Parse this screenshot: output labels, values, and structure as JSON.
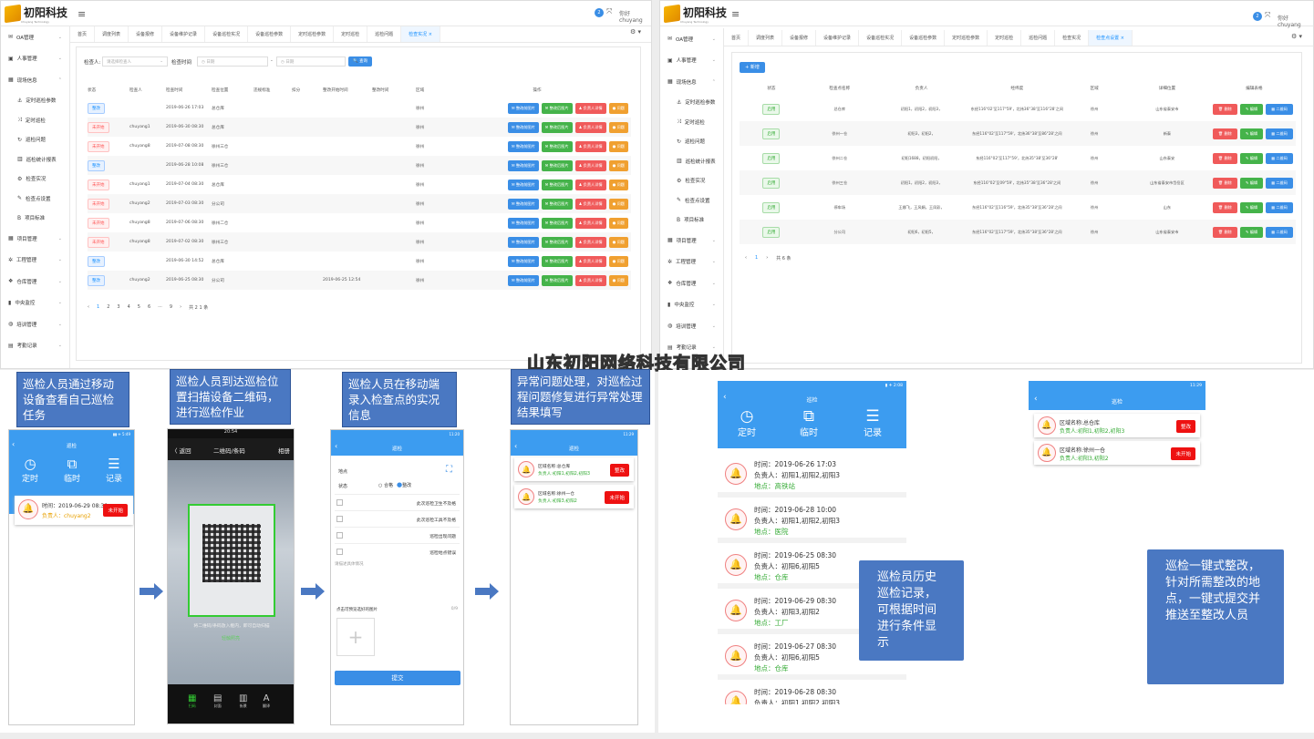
{
  "company_logo": "初阳科技",
  "company_logo_sub": "Chuyang Technology",
  "user_greeting": "你好 chuyang",
  "user_badge": "2",
  "watermark": "山东初阳网络科技有限公司",
  "left_window": {
    "sidebar": [
      {
        "label": "OA管理",
        "icon": "mail-icon",
        "chevron": "⌄",
        "sub": false
      },
      {
        "label": "人事管理",
        "icon": "id-card-icon",
        "chevron": "⌄",
        "sub": false
      },
      {
        "label": "现场信息",
        "icon": "grid-icon",
        "chevron": "⌃",
        "sub": false
      },
      {
        "label": "定时巡检参数",
        "icon": "anchor-icon",
        "sub": true
      },
      {
        "label": "定时巡检",
        "icon": "shuffle-icon",
        "sub": true
      },
      {
        "label": "巡检问题",
        "icon": "refresh-icon",
        "sub": true
      },
      {
        "label": "巡检统计报表",
        "icon": "bar-chart-icon",
        "sub": true
      },
      {
        "label": "检查实况",
        "icon": "gear-icon",
        "sub": true
      },
      {
        "label": "检查点设置",
        "icon": "edit-icon",
        "sub": true
      },
      {
        "label": "项目标准",
        "icon": "bold-icon",
        "sub": true
      },
      {
        "label": "项目管理",
        "icon": "grid-icon",
        "chevron": "⌄",
        "sub": false
      },
      {
        "label": "工程管理",
        "icon": "settings-icon",
        "chevron": "⌄",
        "sub": false
      },
      {
        "label": "仓库管理",
        "icon": "cube-icon",
        "chevron": "⌄",
        "sub": false
      },
      {
        "label": "中央监控",
        "icon": "monitor-icon",
        "chevron": "⌄",
        "sub": false
      },
      {
        "label": "培训管理",
        "icon": "globe-icon",
        "chevron": "⌄",
        "sub": false
      },
      {
        "label": "考勤记录",
        "icon": "calendar-icon",
        "chevron": "⌄",
        "sub": false
      }
    ],
    "tabs": [
      "首页",
      "调度列表",
      "设备报修",
      "设备维护记录",
      "设备巡检实况",
      "设备巡检参数",
      "定时巡检参数",
      "定时巡检",
      "巡检问题",
      "检查实况 ×"
    ],
    "active_tab": 9,
    "filter": {
      "person_label": "检查人:",
      "person_placeholder": "请选择检查人",
      "time_label": "检查时间",
      "date_placeholder": "◷ 日期",
      "dash": "-",
      "search_btn": "🔍 查询"
    },
    "columns": [
      "状态",
      "检查人",
      "检查时间",
      "检查位置",
      "违规标准",
      "扣分",
      "整改开始时间",
      "整改时间",
      "区域",
      "操作"
    ],
    "rows": [
      {
        "status": "整改",
        "status_type": "b",
        "person": "",
        "time": "2019-06-26 17:03",
        "place": "总仓库",
        "start": "",
        "area": "徐州"
      },
      {
        "status": "未开始",
        "status_type": "r",
        "person": "chuyang1",
        "time": "2019-06-30 08:30",
        "place": "总仓库",
        "start": "",
        "area": "徐州"
      },
      {
        "status": "未开始",
        "status_type": "r",
        "person": "chuyang8",
        "time": "2019-07-08 08:30",
        "place": "徐州三仓",
        "start": "",
        "area": "徐州"
      },
      {
        "status": "整改",
        "status_type": "b",
        "person": "",
        "time": "2019-06-28 10:08",
        "place": "徐州三仓",
        "start": "",
        "area": "徐州"
      },
      {
        "status": "未开始",
        "status_type": "r",
        "person": "chuyang1",
        "time": "2019-07-04 08:30",
        "place": "总仓库",
        "start": "",
        "area": "徐州"
      },
      {
        "status": "未开始",
        "status_type": "r",
        "person": "chuyang2",
        "time": "2019-07-03 08:30",
        "place": "分公司",
        "start": "",
        "area": "徐州"
      },
      {
        "status": "未开始",
        "status_type": "r",
        "person": "chuyang8",
        "time": "2019-07-06 08:30",
        "place": "徐州二仓",
        "start": "",
        "area": "徐州"
      },
      {
        "status": "未开始",
        "status_type": "r",
        "person": "chuyang8",
        "time": "2019-07-02 08:30",
        "place": "徐州三仓",
        "start": "",
        "area": "徐州"
      },
      {
        "status": "整改",
        "status_type": "b",
        "person": "",
        "time": "2019-06-30 14:52",
        "place": "总仓库",
        "start": "",
        "area": "徐州"
      },
      {
        "status": "整改",
        "status_type": "b",
        "person": "chuyang2",
        "time": "2019-06-25 08:30",
        "place": "分公司",
        "start": "2019-06-25 12:54",
        "area": "徐州"
      }
    ],
    "row_actions": [
      "整改前图片",
      "整改后图片",
      "负责人详情",
      "问题"
    ],
    "pagination": [
      "‹",
      "1",
      "2",
      "3",
      "4",
      "5",
      "6",
      "···",
      "9",
      "›",
      "共 2 1 条"
    ]
  },
  "right_window": {
    "sidebar": [
      {
        "label": "OA管理",
        "icon": "mail-icon",
        "chevron": "⌄",
        "sub": false
      },
      {
        "label": "人事管理",
        "icon": "id-card-icon",
        "chevron": "⌄",
        "sub": false
      },
      {
        "label": "现场信息",
        "icon": "grid-icon",
        "chevron": "⌃",
        "sub": false
      },
      {
        "label": "定时巡检参数",
        "icon": "anchor-icon",
        "sub": true
      },
      {
        "label": "定时巡检",
        "icon": "shuffle-icon",
        "sub": true
      },
      {
        "label": "巡检问题",
        "icon": "refresh-icon",
        "sub": true
      },
      {
        "label": "巡检统计报表",
        "icon": "bar-chart-icon",
        "sub": true
      },
      {
        "label": "检查实况",
        "icon": "gear-icon",
        "sub": true
      },
      {
        "label": "检查点设置",
        "icon": "edit-icon",
        "sub": true
      },
      {
        "label": "项目标准",
        "icon": "bold-icon",
        "sub": true
      },
      {
        "label": "项目管理",
        "icon": "grid-icon",
        "chevron": "⌄",
        "sub": false
      },
      {
        "label": "工程管理",
        "icon": "settings-icon",
        "chevron": "⌄",
        "sub": false
      },
      {
        "label": "仓库管理",
        "icon": "cube-icon",
        "chevron": "⌄",
        "sub": false
      },
      {
        "label": "中央监控",
        "icon": "monitor-icon",
        "chevron": "⌄",
        "sub": false
      },
      {
        "label": "培训管理",
        "icon": "globe-icon",
        "chevron": "⌄",
        "sub": false
      },
      {
        "label": "考勤记录",
        "icon": "calendar-icon",
        "chevron": "⌄",
        "sub": false
      }
    ],
    "tabs": [
      "首页",
      "调度列表",
      "设备报修",
      "设备维护记录",
      "设备巡检实况",
      "设备巡检参数",
      "定时巡检参数",
      "定时巡检",
      "巡检问题",
      "检查实况",
      "检查点设置 ×"
    ],
    "active_tab": 10,
    "add_btn": "+ 新增",
    "columns": [
      "状态",
      "检查点名称",
      "负责人",
      "经纬度",
      "区域",
      "详细位置",
      "编辑表格"
    ],
    "rows": [
      {
        "status": "启用",
        "name": "总仓库",
        "owner": "初阳1，初阳2，初阳3，",
        "latlng": "东经116°02'至117°59'，北纬36°38'至116°28'之间",
        "area": "徐州",
        "addr": "山东省泰安市"
      },
      {
        "status": "启用",
        "name": "徐州一仓",
        "owner": "初阳3，初阳2，",
        "latlng": "东经116°02'至117°59'，北纬36°38'至86°28'之间",
        "area": "徐州",
        "addr": "新泰"
      },
      {
        "status": "启用",
        "name": "徐州二仓",
        "owner": "初阳1688，初阳初阳，",
        "latlng": "东经116°02'至117°59'，北纬35°38'至36°28'",
        "area": "徐州",
        "addr": "山东泰安"
      },
      {
        "status": "启用",
        "name": "徐州三仓",
        "owner": "初阳1，初阳2，初阳3，",
        "latlng": "东经116°02'至09°59'，北纬35°38'至36°28'之间",
        "area": "徐州",
        "addr": "山东省泰安市岱岳区"
      },
      {
        "status": "启用",
        "name": "停车场",
        "owner": "王娜飞，王风娟，王凤彩，",
        "latlng": "东经116°02'至116°59'，北纬35°38'至36°28'之间",
        "area": "徐州",
        "addr": "山东"
      },
      {
        "status": "启用",
        "name": "分公司",
        "owner": "初阳6，初阳5，",
        "latlng": "东经116°02'至117°59'，北纬35°38'至36°28'之间",
        "area": "徐州",
        "addr": "山东省泰安市"
      }
    ],
    "row_actions": [
      "删除",
      "编辑",
      "二维码"
    ],
    "pagination": [
      "‹",
      "1",
      "›",
      "共 6 条"
    ]
  },
  "callouts": {
    "c1": "巡检人员通过移动设备查看自己巡检任务",
    "c2": "巡检人员到达巡检位置扫描设备二维码，进行巡检作业",
    "c3": "巡检人员在移动端录入检查点的实况信息",
    "c4": "异常问题处理，对巡检过程问题修复进行异常处理结果填写",
    "c5": "巡检员历史巡检记录，可根据时间进行条件显示",
    "c6": "巡检一键式整改，针对所需整改的地点，一键式提交并推送至整改人员"
  },
  "phone1": {
    "title": "巡检",
    "tabs": [
      "定时",
      "临时",
      "记录"
    ],
    "record_time": "时间：2019-06-29 08:30",
    "record_owner": "负责人：chuyang2",
    "btn": "未开始",
    "status": "▮▮ ✈ 5:49"
  },
  "phone2": {
    "status": "20:54",
    "back": "〈 返回",
    "title": "二维码/条码",
    "album": "相册",
    "hint": "将二维码/条码放入框内，即可自动扫描",
    "light": "轻触照亮",
    "bottom": [
      "扫码",
      "封面",
      "街景",
      "翻译"
    ]
  },
  "phone3": {
    "title": "巡检",
    "location_label": "地点",
    "state_label": "状态",
    "opt1": "合格",
    "opt2": "整改",
    "checks": [
      "此次巡检卫生不及格",
      "此次巡检工具不及格",
      "巡检出现问题",
      "巡检地点错误"
    ],
    "placeholder": "请描述具体情况",
    "photo_label": "点击可预览选好的图片",
    "photo_count": "0/9",
    "submit": "提交",
    "status": "11:20"
  },
  "phone4": {
    "title": "巡检",
    "items": [
      {
        "area": "区域名称:总仓库",
        "owner": "负责人:初阳1,初阳2,初阳3",
        "btn": "整改"
      },
      {
        "area": "区域名称:徐州一仓",
        "owner": "负责人:初阳3,初阳2",
        "btn": "未开始"
      }
    ],
    "status": "11:29"
  },
  "phone5": {
    "title": "巡检",
    "tabs": [
      "定时",
      "临时",
      "记录"
    ],
    "status": "▮ ✈ 2:08",
    "records": [
      {
        "time": "时间：2019-06-26 17:03",
        "owner": "负责人：初阳1,初阳2,初阳3",
        "loc": "地点：高铁站"
      },
      {
        "time": "时间：2019-06-28 10:00",
        "owner": "负责人：初阳1,初阳2,初阳3",
        "loc": "地点：医院"
      },
      {
        "time": "时间：2019-06-25 08:30",
        "owner": "负责人：初阳6,初阳5",
        "loc": "地点：仓库"
      },
      {
        "time": "时间：2019-06-29 08:30",
        "owner": "负责人：初阳3,初阳2",
        "loc": "地点：工厂"
      },
      {
        "time": "时间：2019-06-27 08:30",
        "owner": "负责人：初阳6,初阳5",
        "loc": "地点：仓库"
      },
      {
        "time": "时间：2019-06-28 08:30",
        "owner": "负责人：初阳1,初阳2,初阳3",
        "loc": ""
      }
    ]
  },
  "phone6": {
    "title": "巡检",
    "status": "11:29",
    "items": [
      {
        "area": "区域名称:总仓库",
        "owner": "负责人:初阳1,初阳2,初阳3",
        "btn": "整改"
      },
      {
        "area": "区域名称:徐州一仓",
        "owner": "负责人:初阳3,初阳2",
        "btn": "未开始"
      }
    ]
  }
}
